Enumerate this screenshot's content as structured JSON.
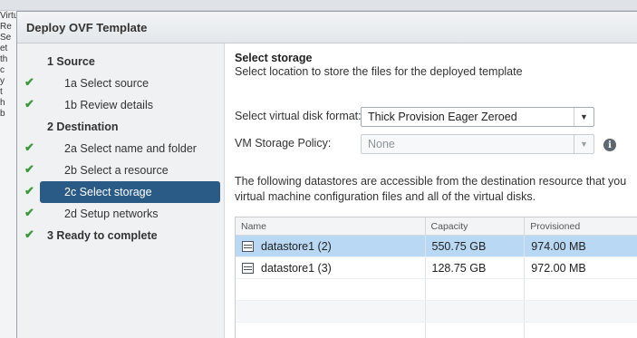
{
  "background": {
    "edge_fragments": [
      "Virtual",
      "Re",
      "Se",
      "et",
      "th",
      "c",
      "y",
      "t",
      "h",
      "b"
    ]
  },
  "dialog": {
    "title": "Deploy OVF Template"
  },
  "nav": {
    "items": [
      {
        "label": "1 Source",
        "type": "section",
        "checked": false
      },
      {
        "label": "1a Select source",
        "type": "sub",
        "checked": true
      },
      {
        "label": "1b Review details",
        "type": "sub",
        "checked": true
      },
      {
        "label": "2 Destination",
        "type": "section",
        "checked": false
      },
      {
        "label": "2a Select name and folder",
        "type": "sub",
        "checked": true
      },
      {
        "label": "2b Select a resource",
        "type": "sub",
        "checked": true
      },
      {
        "label": "2c Select storage",
        "type": "sub",
        "checked": true,
        "active": true
      },
      {
        "label": "2d Setup networks",
        "type": "sub",
        "checked": true
      },
      {
        "label": "3 Ready to complete",
        "type": "section",
        "checked": true
      }
    ]
  },
  "content": {
    "title": "Select storage",
    "subtitle": "Select location to store the files for the deployed template",
    "disk_format_label": "Select virtual disk format:",
    "disk_format_value": "Thick Provision Eager Zeroed",
    "policy_label": "VM Storage Policy:",
    "policy_value": "None",
    "description_line1": "The following datastores are accessible from the destination resource that you",
    "description_line2": "virtual machine configuration files and all of the virtual disks."
  },
  "table": {
    "columns": [
      "Name",
      "Capacity",
      "Provisioned"
    ],
    "rows": [
      {
        "name": "datastore1 (2)",
        "capacity": "550.75 GB",
        "provisioned": "974.00 MB",
        "selected": true
      },
      {
        "name": "datastore1 (3)",
        "capacity": "128.75 GB",
        "provisioned": "972.00 MB",
        "selected": false
      }
    ]
  },
  "icons": {
    "check": "checkmark-icon",
    "dropdown": "chevron-down-icon",
    "info": "info-icon",
    "datastore": "datastore-icon"
  },
  "colors": {
    "accent": "#2a5b86",
    "check": "#3a9a3a",
    "selected_row": "#b8d8f4"
  }
}
